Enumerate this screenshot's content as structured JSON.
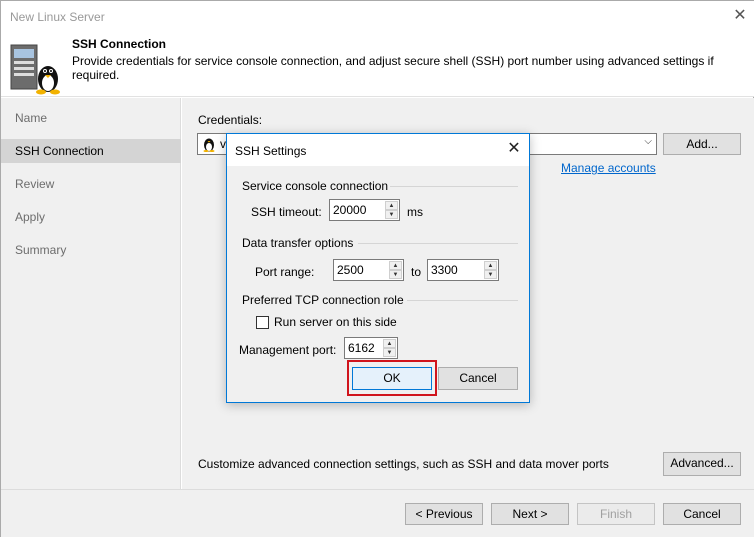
{
  "window": {
    "title": "New Linux Server"
  },
  "header": {
    "title": "SSH Connection",
    "description": "Provide credentials for service console connection, and adjust secure shell (SSH) port number using advanced settings if required."
  },
  "sidebar": {
    "items": [
      {
        "label": "Name"
      },
      {
        "label": "SSH Connection"
      },
      {
        "label": "Review"
      },
      {
        "label": "Apply"
      },
      {
        "label": "Summary"
      }
    ]
  },
  "main": {
    "credentials_label": "Credentials:",
    "credentials_value": "v",
    "add_label": "Add...",
    "manage_accounts": "Manage accounts",
    "advanced_text": "Customize advanced connection settings, such as SSH and data mover ports",
    "advanced_label": "Advanced..."
  },
  "footer": {
    "previous": "< Previous",
    "next": "Next >",
    "finish": "Finish",
    "cancel": "Cancel"
  },
  "dialog": {
    "title": "SSH Settings",
    "service_group": "Service console connection",
    "ssh_timeout_label": "SSH timeout:",
    "ssh_timeout_value": "20000",
    "ssh_timeout_unit": "ms",
    "data_group": "Data transfer options",
    "port_range_label": "Port range:",
    "port_from": "2500",
    "port_to_label": "to",
    "port_to": "3300",
    "tcp_group": "Preferred TCP connection role",
    "run_server_label": "Run server on this side",
    "run_server_checked": false,
    "mgmt_port_label": "Management port:",
    "mgmt_port_value": "6162",
    "ok": "OK",
    "cancel": "Cancel"
  },
  "colors": {
    "accent": "#0078d7",
    "highlight": "#d0141c",
    "link": "#0066cc"
  }
}
